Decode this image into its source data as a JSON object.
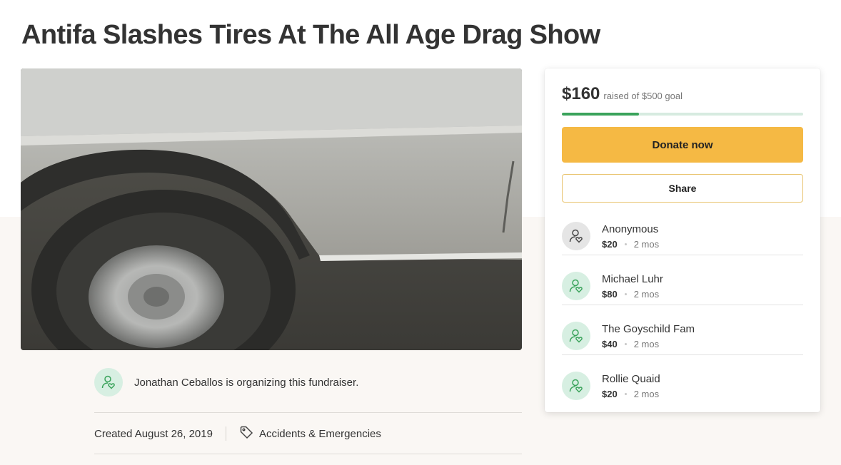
{
  "page": {
    "title": "Antifa Slashes Tires At The All Age Drag Show"
  },
  "organizer": {
    "text": "Jonathan Ceballos is organizing this fundraiser.",
    "icon": "user-heart-icon"
  },
  "meta": {
    "created": "Created August 26, 2019",
    "category": "Accidents & Emergencies",
    "category_icon": "tag-icon"
  },
  "donation": {
    "raised": "$160",
    "goal_text": "raised of $500 goal",
    "progress_fraction": 0.32,
    "donate_label": "Donate now",
    "share_label": "Share",
    "donors": [
      {
        "name": "Anonymous",
        "amount": "$20",
        "time": "2 mos",
        "icon": "anonymous-user-icon"
      },
      {
        "name": "Michael Luhr",
        "amount": "$80",
        "time": "2 mos",
        "icon": "user-heart-icon"
      },
      {
        "name": "The Goyschild Fam",
        "amount": "$40",
        "time": "2 mos",
        "icon": "user-heart-icon"
      },
      {
        "name": "Rollie Quaid",
        "amount": "$20",
        "time": "2 mos",
        "icon": "user-heart-icon"
      }
    ]
  },
  "colors": {
    "accent_green": "#3aa35b",
    "donate_yellow": "#f5b944",
    "background_warm": "#faf7f4"
  }
}
